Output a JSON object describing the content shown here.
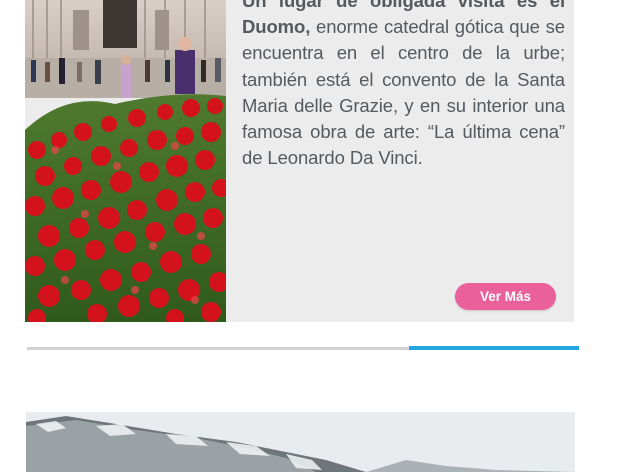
{
  "article": {
    "text_lead": "Un lugar de obligada visita es el Duomo,",
    "text_body": " enorme catedral gótica que se encuentra en el centro de la urbe; también está el convento de la Santa Maria delle Grazie, y en su interior una famosa obra de arte: “La última cena” de Leonardo Da Vinci.",
    "button_label": "Ver Más"
  },
  "colors": {
    "card_bg": "#ececec",
    "text": "#555a5f",
    "button_bg": "#e9609a",
    "divider_grey": "#d2d2d2",
    "divider_blue": "#24a6e0"
  }
}
